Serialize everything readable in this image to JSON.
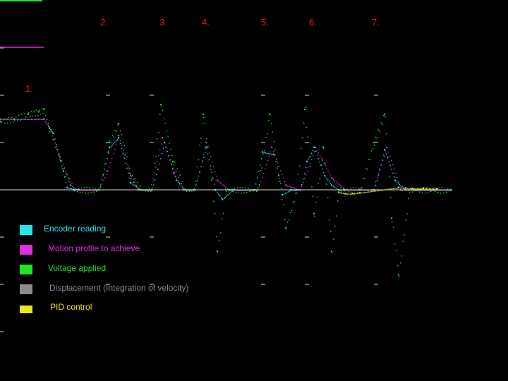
{
  "chart_data": {
    "type": "scatter",
    "title": "",
    "xlabel": "",
    "ylabel": "",
    "background": "#000000",
    "grid": false,
    "x_range": [
      0,
      640
    ],
    "y_range": [
      -2.0,
      2.5
    ],
    "baseline_y": 0,
    "segment_markers": [
      "1.",
      "2.",
      "3.",
      "4.",
      "5.",
      "6.",
      "7."
    ],
    "legend_placement": "bottom-left",
    "series": [
      {
        "name": "Encoder reading",
        "color": "#22e6f0",
        "x": [
          0,
          62,
          75,
          95,
          112,
          140,
          155,
          168,
          185,
          200,
          215,
          233,
          250,
          262,
          275,
          292,
          305,
          315,
          330,
          360,
          372,
          388,
          400,
          412,
          425,
          435,
          445,
          460,
          470,
          480,
          490,
          510,
          530,
          545,
          560,
          575,
          595,
          640
        ],
        "y": [
          1.5,
          1.5,
          1.2,
          0.05,
          0.0,
          0.0,
          0.9,
          1.1,
          0.15,
          0.0,
          0.0,
          1.0,
          0.2,
          0.0,
          0.0,
          0.9,
          0.0,
          -0.2,
          0.0,
          0.0,
          0.8,
          0.75,
          -0.1,
          0.0,
          0.0,
          0.6,
          0.9,
          0.3,
          0.1,
          0.0,
          0.0,
          0.0,
          0.0,
          0.85,
          0.2,
          0.0,
          0.0,
          0.0
        ]
      },
      {
        "name": "Motion profile to achieve",
        "color": "#e02ee0",
        "x": [
          0,
          62,
          70,
          85,
          100,
          110,
          140,
          152,
          168,
          184,
          196,
          212,
          230,
          246,
          260,
          276,
          292,
          308,
          325,
          365,
          385,
          405,
          425,
          447,
          470,
          490,
          528,
          548,
          568,
          640
        ],
        "y": [
          1.5,
          1.5,
          1.3,
          0.7,
          0.1,
          0.0,
          0.0,
          0.4,
          1.15,
          0.35,
          0.0,
          0.0,
          1.1,
          0.35,
          0.0,
          0.0,
          1.0,
          0.2,
          0.0,
          0.0,
          0.9,
          0.1,
          0.0,
          0.9,
          0.25,
          0.0,
          0.0,
          0.9,
          0.0,
          0.0
        ]
      },
      {
        "name": "Voltage applied",
        "color": "#1ee61e",
        "x": [
          0,
          20,
          40,
          55,
          62,
          70,
          90,
          105,
          140,
          155,
          168,
          185,
          200,
          215,
          228,
          245,
          262,
          275,
          288,
          300,
          308,
          320,
          365,
          382,
          395,
          405,
          420,
          432,
          445,
          458,
          470,
          480,
          510,
          530,
          545,
          555,
          565,
          580,
          640
        ],
        "y": [
          1.45,
          1.5,
          1.6,
          1.65,
          1.7,
          1.3,
          0.4,
          0.0,
          0.0,
          1.0,
          1.4,
          0.3,
          0.0,
          0.0,
          1.8,
          0.6,
          0.0,
          0.0,
          1.6,
          0.2,
          -1.3,
          0.0,
          0.0,
          1.6,
          0.3,
          -0.8,
          0.0,
          1.7,
          -0.5,
          0.9,
          -1.3,
          0.0,
          0.0,
          1.0,
          1.6,
          -0.6,
          -1.8,
          0.0,
          0.0
        ]
      },
      {
        "name": "Displacement (Integration of velocity)",
        "color": "#8c8c8c",
        "x": [
          0,
          640
        ],
        "y": [
          0.0,
          0.0
        ]
      },
      {
        "name": "PID control",
        "color": "#e6e619",
        "x": [
          480,
          490,
          500,
          510,
          565,
          575,
          585,
          600,
          620
        ],
        "y": [
          -0.05,
          -0.08,
          -0.08,
          -0.06,
          0.05,
          0.04,
          0.03,
          0.03,
          0.03
        ]
      }
    ]
  }
}
